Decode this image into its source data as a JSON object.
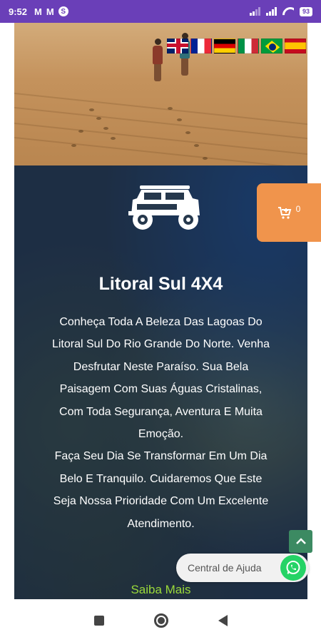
{
  "status_bar": {
    "time": "9:52",
    "notifications": [
      "M",
      "M",
      "S"
    ],
    "battery": "93"
  },
  "hero": {
    "languages": [
      "english-flag",
      "french-flag",
      "german-flag",
      "italian-flag",
      "brazilian-flag",
      "spanish-flag"
    ]
  },
  "main": {
    "title": "Litoral Sul 4X4",
    "description": "Conheça Toda A Beleza Das Lagoas Do Litoral Sul Do Rio Grande Do Norte. Venha Desfrutar Neste Paraíso. Sua Bela Paisagem Com Suas Águas Cristalinas, Com Toda Segurança, Aventura E Muita Emoção.",
    "description2": "Faça Seu Dia Se Transformar Em Um Dia Belo E Tranquilo. Cuidaremos Que Este Seja Nossa Prioridade Com Um Excelente Atendimento.",
    "more_link": "Saiba Mais"
  },
  "cart": {
    "count": "0"
  },
  "help_widget": {
    "label": "Central de Ajuda"
  },
  "colors": {
    "status_bar": "#6a3fb8",
    "cart": "#f0944c",
    "link": "#9ad93a",
    "whatsapp": "#25d366",
    "scroll_top": "#3c8a62"
  },
  "icons": {
    "cart": "cart-plus-icon",
    "whatsapp": "whatsapp-icon",
    "scroll_top": "chevron-up-icon",
    "logo": "jeep-icon"
  }
}
